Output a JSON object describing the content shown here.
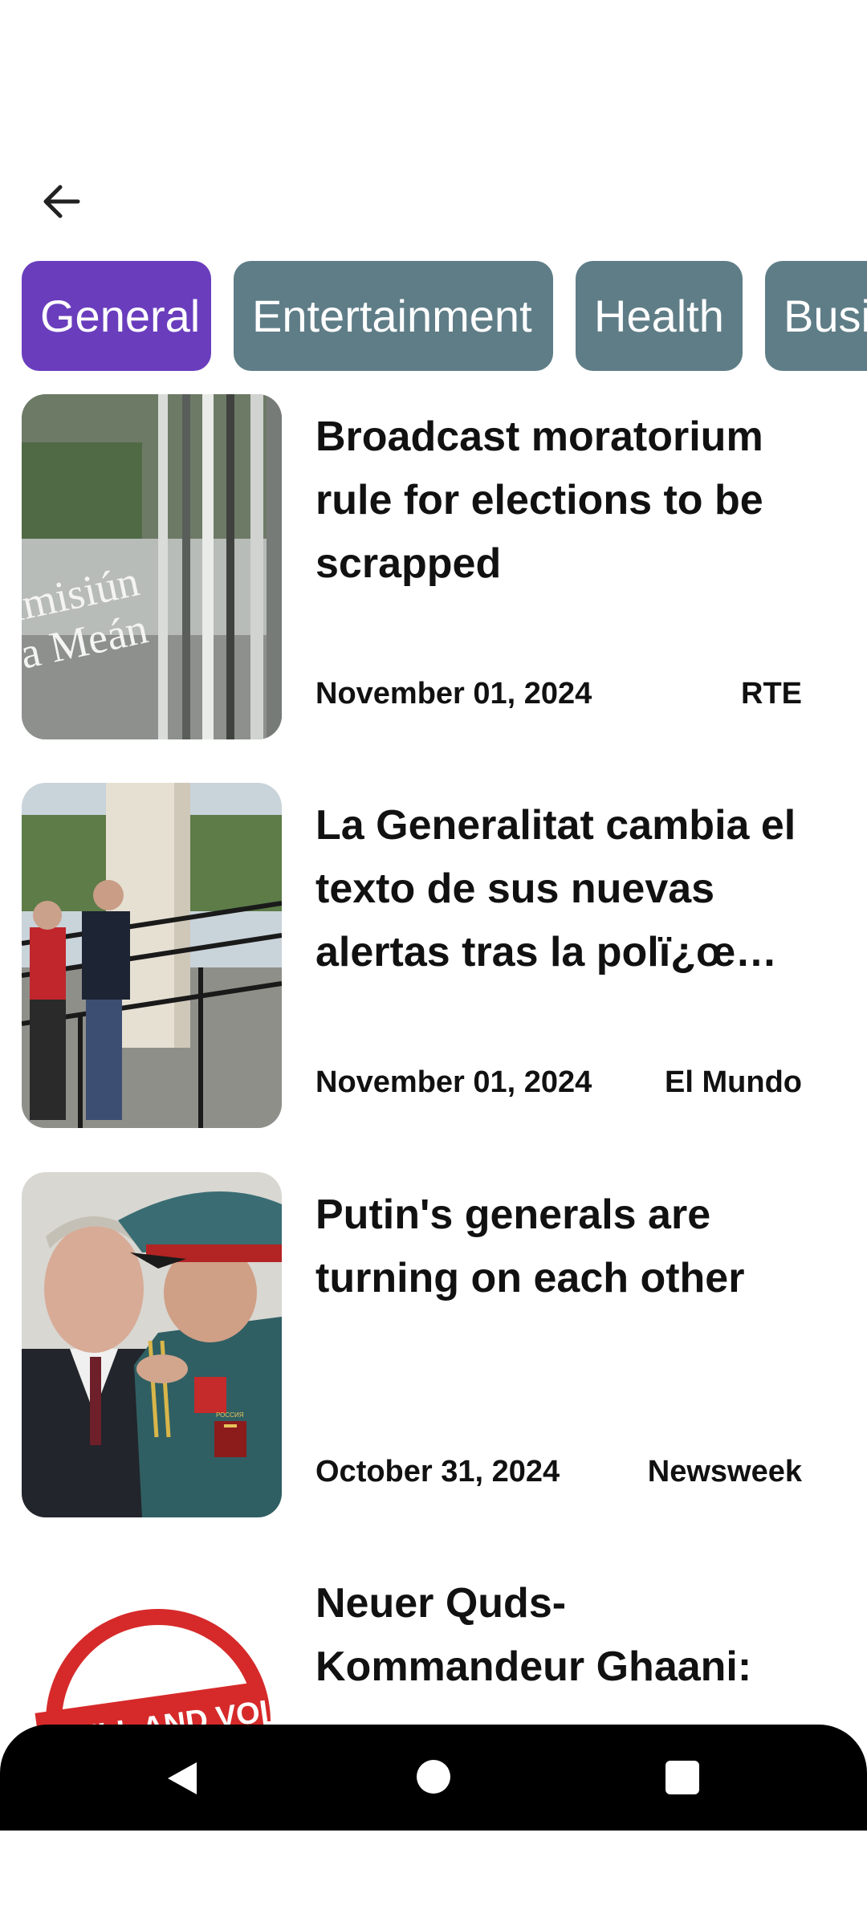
{
  "categories": [
    "General",
    "Entertainment",
    "Health",
    "Business"
  ],
  "active_category": "General",
  "articles": [
    {
      "title": "Broadcast moratorium rule for elections to be scrapped",
      "date": "November 01, 2024",
      "source": "RTE",
      "thumb_text": [
        "imisiún",
        "a Meán"
      ]
    },
    {
      "title": "La Generalitat cambia el texto de sus nuevas alertas tras la polï¿œ…",
      "date": "November 01, 2024",
      "source": "El Mundo"
    },
    {
      "title": "Putin's generals are turning on each other",
      "date": "October 31, 2024",
      "source": "Newsweek",
      "thumb_text": [
        "РОССИЯ"
      ]
    },
    {
      "title": "Neuer Quds-Kommandeur Ghaani:",
      "thumb_text": [
        "NULL AND VOID"
      ]
    }
  ],
  "icons": {
    "back": "arrow-left-icon",
    "nav_back": "triangle-back-icon",
    "nav_home": "circle-home-icon",
    "nav_recent": "square-recent-icon"
  },
  "colors": {
    "chip_active": "#6a3dbd",
    "chip_inactive": "#5f7d87"
  }
}
